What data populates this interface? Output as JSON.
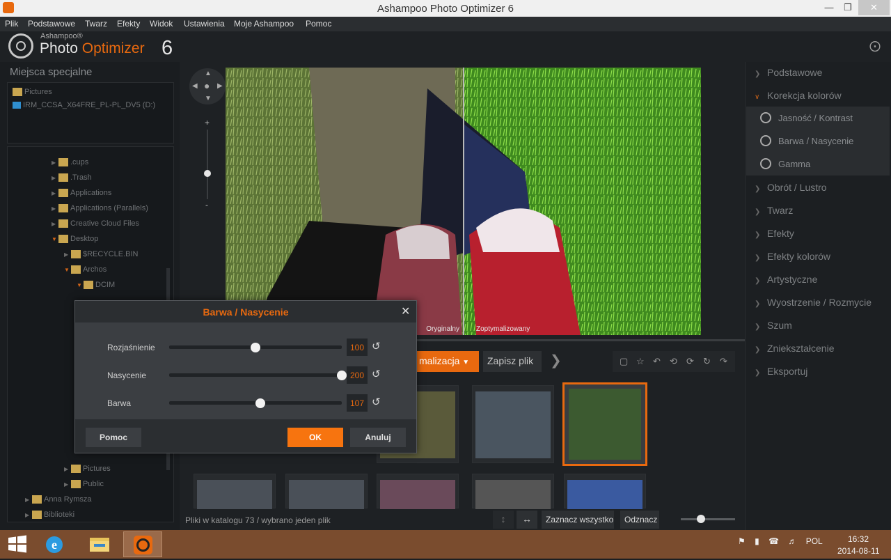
{
  "window": {
    "title": "Ashampoo Photo Optimizer 6"
  },
  "menu": [
    "Plik",
    "Podstawowe",
    "Twarz",
    "Efekty",
    "Widok",
    "Ustawienia",
    "Moje Ashampoo",
    "Pomoc"
  ],
  "logo": {
    "brand": "Ashampoo®",
    "name_a": "Photo",
    "name_b": "Optimizer",
    "version": "6"
  },
  "left_panel": {
    "title": "Miejsca specjalne",
    "special_places": [
      "Pictures",
      "IRM_CCSA_X64FRE_PL-PL_DV5 (D:)"
    ],
    "tree": [
      {
        "label": ".cups"
      },
      {
        "label": ".Trash"
      },
      {
        "label": "Applications"
      },
      {
        "label": "Applications (Parallels)"
      },
      {
        "label": "Creative Cloud Files"
      },
      {
        "label": "Desktop"
      },
      {
        "label": "$RECYCLE.BIN"
      },
      {
        "label": "Archos"
      },
      {
        "label": "DCIM"
      },
      {
        "label": "Pictures"
      },
      {
        "label": "Public"
      },
      {
        "label": "Anna Rymsza"
      },
      {
        "label": "Biblioteki"
      }
    ]
  },
  "viewer": {
    "label_original": "Oryginalny",
    "label_optimized": "Zoptymalizowany",
    "zoom_plus": "+",
    "zoom_minus": "-"
  },
  "toolbar": {
    "optimize_label": "malizacja",
    "save_label": "Zapisz plik"
  },
  "status": {
    "text": "Pliki w katalogu 73 / wybrano jeden plik",
    "select_all": "Zaznacz wszystko",
    "deselect": "Odznacz"
  },
  "right_panel": {
    "categories": [
      {
        "label": "Podstawowe",
        "open": false
      },
      {
        "label": "Korekcja kolorów",
        "open": true
      },
      {
        "label": "Obrót / Lustro",
        "open": false
      },
      {
        "label": "Twarz",
        "open": false
      },
      {
        "label": "Efekty",
        "open": false
      },
      {
        "label": "Efekty kolorów",
        "open": false
      },
      {
        "label": "Artystyczne",
        "open": false
      },
      {
        "label": "Wyostrzenie / Rozmycie",
        "open": false
      },
      {
        "label": "Szum",
        "open": false
      },
      {
        "label": "Zniekształcenie",
        "open": false
      },
      {
        "label": "Eksportuj",
        "open": false
      }
    ],
    "subitems": [
      "Jasność / Kontrast",
      "Barwa / Nasycenie",
      "Gamma"
    ]
  },
  "dialog": {
    "title": "Barwa / Nasycenie",
    "sliders": [
      {
        "label": "Rozjaśnienie",
        "value": "100",
        "fraction": 0.5
      },
      {
        "label": "Nasycenie",
        "value": "200",
        "fraction": 1.0
      },
      {
        "label": "Barwa",
        "value": "107",
        "fraction": 0.53
      }
    ],
    "help": "Pomoc",
    "ok": "OK",
    "cancel": "Anuluj"
  },
  "taskbar": {
    "lang": "POL",
    "time": "16:32",
    "date": "2014-08-11"
  },
  "colors": {
    "accent": "#e8690f",
    "background": "#1c1f22",
    "panel": "#2b2e31"
  }
}
